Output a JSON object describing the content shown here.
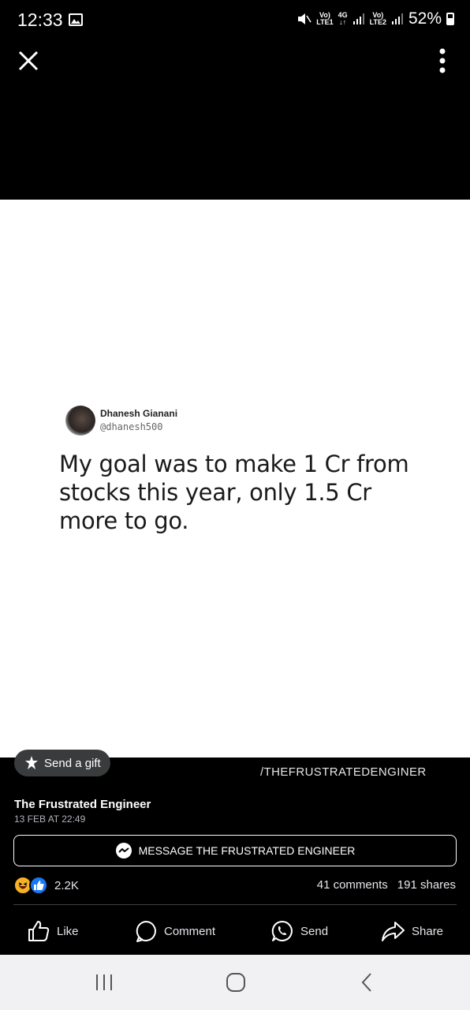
{
  "status_bar": {
    "time": "12:33",
    "sim1_label": "Vo)",
    "sim1_sub": "LTE1",
    "network_4g": "4G",
    "sim2_label": "Vo)",
    "sim2_sub": "LTE2",
    "battery": "52%"
  },
  "tweet": {
    "name": "Dhanesh Gianani",
    "handle": "@dhanesh500",
    "text": "My goal was to make 1 Cr from stocks this year, only 1.5 Cr more to go."
  },
  "overlay": {
    "gift_label": "Send a gift",
    "watermark": "/THEFRUSTRATEDENGINER"
  },
  "post": {
    "page_name": "The Frustrated Engineer",
    "date": "13 FEB AT 22:49",
    "message_button": "MESSAGE THE FRUSTRATED ENGINEER",
    "reaction_count": "2.2K",
    "comments": "41 comments",
    "shares": "191 shares"
  },
  "actions": {
    "like": "Like",
    "comment": "Comment",
    "send": "Send",
    "share": "Share"
  },
  "icons": [
    "close-icon",
    "more-icon",
    "gallery-icon",
    "mute-icon",
    "gift-icon",
    "messenger-icon",
    "haha-icon",
    "like-reaction-icon",
    "like-icon",
    "comment-icon",
    "whatsapp-icon",
    "share-icon",
    "recents-icon",
    "home-icon",
    "back-icon"
  ],
  "colors": {
    "accent_blue": "#1877f2",
    "haha_yellow": "#f7b125",
    "dark_gray": "#3a3b3c"
  }
}
